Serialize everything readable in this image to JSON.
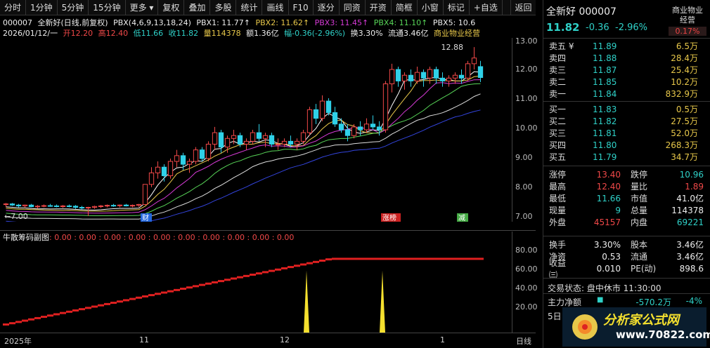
{
  "toolbar": {
    "items": [
      "分时",
      "1分钟",
      "5分钟",
      "15分钟",
      "更多 ▾",
      "复权",
      "叠加",
      "多股",
      "统计",
      "画线",
      "F10",
      "逐分",
      "同资",
      "开资",
      "简框",
      "小窗",
      "标记",
      "+自选"
    ],
    "back": "返回"
  },
  "info1": {
    "code": "000007",
    "name": "全新好(日线,前复权)",
    "pbx": "PBX(4,6,9,13,18,24)",
    "pbx1": "PBX1: 11.77↑",
    "pbx2": "PBX2: 11.62↑",
    "pbx3": "PBX3: 11.45↑",
    "pbx4": "PBX4: 11.10↑",
    "pbx5": "PBX5: 10.6"
  },
  "info2": {
    "date": "2026/01/12/一",
    "open": "开12.20",
    "high": "高12.40",
    "low": "低11.66",
    "close": "收11.82",
    "vol": "量114378",
    "amt": "额1.36亿",
    "amp": "幅-0.36(-2.96%)",
    "turn": "换3.30%",
    "flow": "流通3.46亿",
    "sector": "商业物业经营"
  },
  "axis": {
    "main": [
      "13.00",
      "12.00",
      "11.00",
      "10.00",
      "9.00",
      "8.00",
      "7.00"
    ],
    "sub": [
      "80.00",
      "60.00",
      "40.00",
      "20.00"
    ]
  },
  "annotations": {
    "hi": "12.88",
    "lo": "7.00",
    "tag1": "财",
    "tag2": "涨榜",
    "tag3": "减"
  },
  "subhead": {
    "name": "牛散筹码副图",
    "vals": ": 0.00 : 0.00 : 0.00 : 0.00 : 0.00 : 0.00 : 0.00 : 0.00 : 0.00 : 0.00"
  },
  "xaxis": {
    "y": "2025年",
    "m11": "11",
    "m12": "12",
    "m1": "1",
    "period": "日线"
  },
  "panel": {
    "name": "全新好 000007",
    "price": "11.82",
    "chg": "-0.36",
    "chgp": "-2.96%",
    "industry": "商业物业\n经营",
    "industry_pct": "0.17%",
    "asks": [
      {
        "l": "卖五 ¥",
        "p": "11.89",
        "v": "6.5万"
      },
      {
        "l": "卖四",
        "p": "11.88",
        "v": "28.4万"
      },
      {
        "l": "卖三",
        "p": "11.87",
        "v": "25.4万"
      },
      {
        "l": "卖二",
        "p": "11.85",
        "v": "10.2万"
      },
      {
        "l": "卖一",
        "p": "11.84",
        "v": "832.9万"
      }
    ],
    "bids": [
      {
        "l": "买一",
        "p": "11.83",
        "v": "0.5万"
      },
      {
        "l": "买二",
        "p": "11.82",
        "v": "27.5万"
      },
      {
        "l": "买三",
        "p": "11.81",
        "v": "52.0万"
      },
      {
        "l": "买四",
        "p": "11.80",
        "v": "268.3万"
      },
      {
        "l": "买五",
        "p": "11.79",
        "v": "34.7万"
      }
    ],
    "s1": [
      [
        "涨停",
        "13.40",
        "跌停",
        "10.96"
      ],
      [
        "最高",
        "12.40",
        "量比",
        "1.89"
      ],
      [
        "最低",
        "11.66",
        "市值",
        "41.0亿"
      ],
      [
        "现量",
        "9",
        "总量",
        "114378"
      ],
      [
        "外盘",
        "45157",
        "内盘",
        "69221"
      ]
    ],
    "s2": [
      [
        "换手",
        "3.30%",
        "股本",
        "3.46亿"
      ],
      [
        "净资",
        "0.53",
        "流通",
        "3.46亿"
      ],
      [
        "收益㈢",
        "0.010",
        "PE(动)",
        "898.6"
      ]
    ],
    "tstate": "交易状态: 盘中休市 11:30:00",
    "mainnet": "主力净额",
    "mainval": "-570.2万",
    "mainpct": "-4%",
    "day5": "5日",
    "wm1": "分析家公式网",
    "wm2": "www.70822.com"
  },
  "chart_data": {
    "type": "candlestick",
    "ylim": [
      6.8,
      13.2
    ],
    "hi": 12.88,
    "lo": 7.0,
    "candles": [
      [
        7.4,
        7.45,
        7.3,
        7.42
      ],
      [
        7.42,
        7.45,
        7.35,
        7.38
      ],
      [
        7.38,
        7.42,
        7.3,
        7.35
      ],
      [
        7.35,
        7.4,
        7.28,
        7.38
      ],
      [
        7.38,
        7.42,
        7.3,
        7.32
      ],
      [
        7.32,
        7.38,
        7.25,
        7.34
      ],
      [
        7.34,
        7.4,
        7.3,
        7.36
      ],
      [
        7.36,
        7.42,
        7.32,
        7.35
      ],
      [
        7.35,
        7.4,
        7.3,
        7.33
      ],
      [
        7.33,
        7.38,
        7.28,
        7.35
      ],
      [
        7.35,
        7.4,
        7.3,
        7.34
      ],
      [
        7.34,
        7.38,
        7.25,
        7.3
      ],
      [
        7.3,
        7.35,
        7.22,
        7.28
      ],
      [
        7.28,
        7.32,
        7.0,
        7.3
      ],
      [
        7.3,
        7.36,
        7.25,
        7.33
      ],
      [
        7.33,
        7.38,
        7.28,
        7.35
      ],
      [
        7.35,
        7.4,
        7.3,
        7.37
      ],
      [
        7.37,
        7.42,
        7.32,
        7.36
      ],
      [
        7.36,
        7.4,
        7.3,
        7.38
      ],
      [
        7.38,
        7.42,
        7.33,
        7.35
      ],
      [
        7.35,
        7.4,
        7.3,
        7.37
      ],
      [
        7.37,
        7.42,
        7.32,
        7.4
      ],
      [
        7.4,
        8.1,
        7.38,
        8.1
      ],
      [
        8.1,
        8.7,
        8.0,
        8.5
      ],
      [
        8.5,
        8.9,
        8.3,
        8.7
      ],
      [
        8.7,
        8.8,
        8.2,
        8.4
      ],
      [
        8.4,
        9.0,
        8.3,
        8.9
      ],
      [
        8.9,
        9.3,
        8.7,
        9.1
      ],
      [
        9.1,
        9.2,
        8.6,
        8.8
      ],
      [
        8.8,
        9.0,
        8.5,
        8.9
      ],
      [
        8.9,
        9.4,
        8.8,
        9.3
      ],
      [
        9.3,
        9.4,
        8.9,
        9.0
      ],
      [
        9.0,
        9.6,
        8.9,
        9.5
      ],
      [
        9.5,
        10.1,
        9.3,
        9.9
      ],
      [
        9.9,
        10.0,
        9.2,
        9.4
      ],
      [
        9.4,
        9.8,
        9.2,
        9.7
      ],
      [
        9.7,
        10.0,
        9.5,
        9.8
      ],
      [
        9.8,
        9.9,
        9.4,
        9.5
      ],
      [
        9.5,
        9.7,
        9.3,
        9.6
      ],
      [
        9.6,
        10.0,
        9.5,
        9.9
      ],
      [
        9.9,
        10.2,
        9.6,
        9.7
      ],
      [
        9.7,
        9.9,
        9.4,
        9.8
      ],
      [
        9.8,
        9.9,
        9.4,
        9.5
      ],
      [
        9.5,
        9.7,
        9.3,
        9.5
      ],
      [
        9.5,
        9.7,
        9.4,
        9.6
      ],
      [
        9.6,
        9.8,
        9.4,
        9.5
      ],
      [
        9.5,
        9.7,
        9.3,
        9.6
      ],
      [
        9.6,
        10.0,
        9.5,
        9.9
      ],
      [
        9.9,
        10.8,
        9.8,
        10.7
      ],
      [
        10.7,
        10.9,
        10.2,
        10.4
      ],
      [
        10.4,
        11.2,
        10.3,
        11.0
      ],
      [
        11.0,
        11.1,
        10.5,
        10.6
      ],
      [
        10.6,
        10.8,
        10.1,
        10.2
      ],
      [
        10.2,
        10.4,
        9.9,
        10.0
      ],
      [
        10.0,
        10.2,
        9.6,
        9.8
      ],
      [
        9.8,
        10.2,
        9.7,
        10.1
      ],
      [
        10.1,
        10.3,
        9.8,
        10.0
      ],
      [
        10.0,
        10.4,
        9.9,
        10.2
      ],
      [
        10.2,
        10.5,
        10.0,
        10.1
      ],
      [
        10.1,
        10.3,
        9.8,
        10.0
      ],
      [
        10.0,
        11.7,
        9.9,
        11.6
      ],
      [
        11.6,
        12.3,
        11.3,
        12.1
      ],
      [
        12.1,
        12.2,
        11.5,
        11.7
      ],
      [
        11.7,
        12.0,
        11.4,
        11.9
      ],
      [
        11.9,
        12.1,
        11.5,
        11.7
      ],
      [
        11.7,
        12.2,
        11.6,
        12.0
      ],
      [
        12.0,
        12.1,
        11.5,
        11.8
      ],
      [
        11.8,
        12.2,
        11.6,
        12.1
      ],
      [
        12.1,
        12.2,
        11.6,
        11.8
      ],
      [
        11.8,
        12.0,
        11.5,
        11.7
      ],
      [
        11.7,
        11.9,
        11.5,
        11.8
      ],
      [
        11.8,
        12.0,
        11.6,
        11.9
      ],
      [
        11.9,
        12.1,
        11.6,
        11.8
      ],
      [
        11.8,
        12.4,
        11.7,
        12.3
      ],
      [
        12.3,
        12.88,
        12.1,
        12.5
      ],
      [
        12.2,
        12.4,
        11.66,
        11.82
      ]
    ]
  }
}
